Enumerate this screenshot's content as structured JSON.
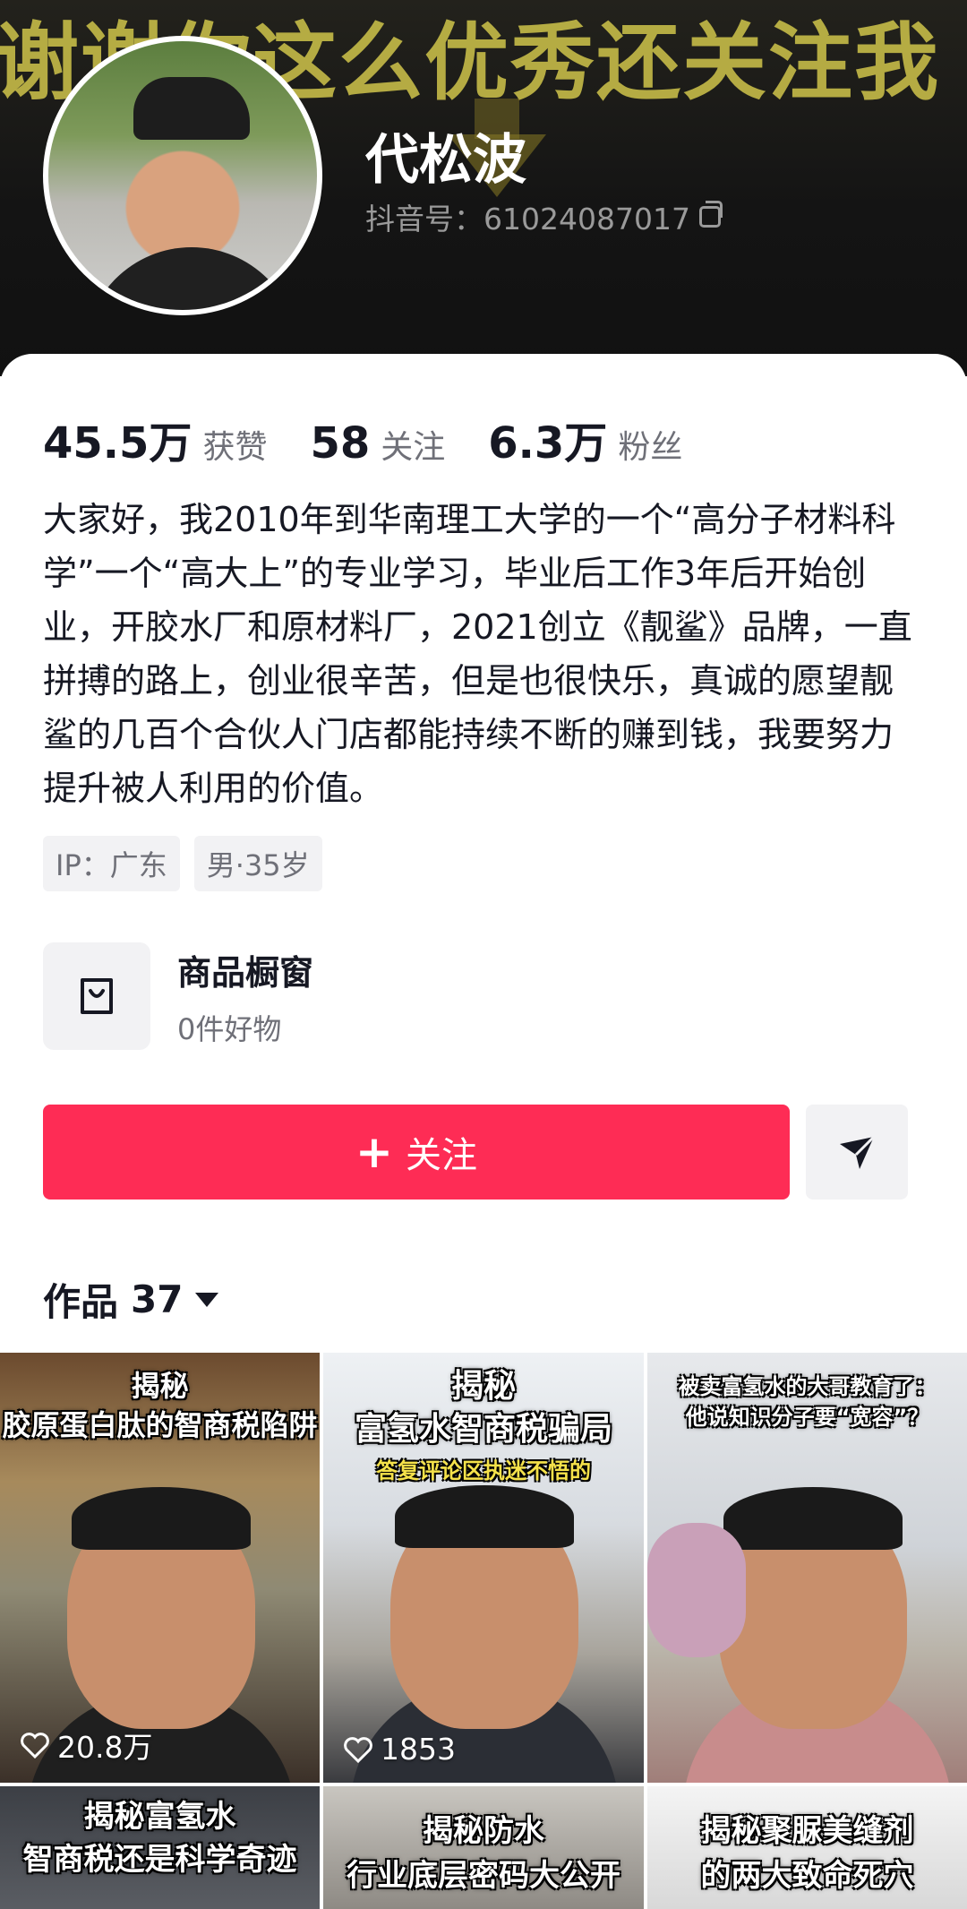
{
  "banner": {
    "text": "谢谢你这么优秀还关注我"
  },
  "profile": {
    "name": "代松波",
    "douyin_id": "抖音号：61024087017"
  },
  "stats": [
    {
      "value": "45.5万",
      "label": "获赞"
    },
    {
      "value": "58",
      "label": "关注"
    },
    {
      "value": "6.3万",
      "label": "粉丝"
    }
  ],
  "bio": "大家好，我2010年到华南理工大学的一个“高分子材料科学”一个“高大上”的专业学习，毕业后工作3年后开始创业，开胶水厂和原材料厂，2021创立《靓鲨》品牌，一直拼搏的路上，创业很辛苦，但是也很快乐，真诚的愿望靓鲨的几百个合伙人门店都能持续不断的赚到钱，我要努力提升被人利用的价值。",
  "tags": [
    "IP：广东",
    "男·35岁"
  ],
  "shop": {
    "title": "商品橱窗",
    "subtitle": "0件好物",
    "icon": "shopping-bag-icon"
  },
  "actions": {
    "follow_label": "关注",
    "follow_icon": "plus-icon",
    "share_icon": "send-icon"
  },
  "works": {
    "title": "作品",
    "count": "37"
  },
  "videos": [
    {
      "title_line1": "揭秘",
      "title_line2": "胶原蛋白肽的智商税陷阱",
      "likes": "20.8万"
    },
    {
      "title_line1": "揭秘",
      "title_line2": "富氢水智商税骗局",
      "subtitle": "答复评论区执迷不悟的",
      "likes": "1853"
    },
    {
      "title_line1": "被卖富氢水的大哥教育了：",
      "title_line2": "他说知识分子要“宽容”？"
    },
    {
      "title_line1": "揭秘富氢水",
      "title_line2": "智商税还是科学奇迹"
    },
    {
      "title_line1": "揭秘防水",
      "title_line2": "行业底层密码大公开"
    },
    {
      "title_line1": "揭秘聚脲美缝剂",
      "title_line2": "的两大致命死穴"
    }
  ],
  "colors": {
    "accent": "#fe2c55",
    "banner_text": "#c2b847",
    "muted": "#6f7078"
  }
}
